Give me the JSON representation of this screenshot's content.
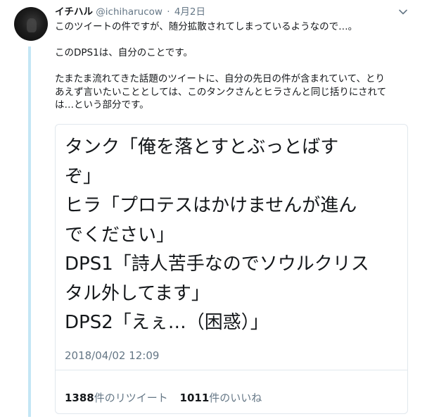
{
  "tweet": {
    "author_name": "イチハル",
    "author_handle": "@ichiharucow",
    "separator": "·",
    "date": "4月2日",
    "text_lines": [
      "このツイートの件ですが、随分拡散されてしまっているようなので…。",
      "",
      "このDPS1は、自分のことです。",
      "",
      "たまたま流れてきた話題のツイートに、自分の先日の件が含まれていて、とり",
      "あえず言いたいこととしては、このタンクさんとヒラさんと同じ括りにされて",
      "は…という部分です。"
    ]
  },
  "quoted": {
    "lines": [
      "タンク「俺を落とすとぶっとばす",
      "ぞ」",
      "ヒラ「プロテスはかけませんが進ん",
      "でください」",
      "DPS1「詩人苦手なのでソウルクリス",
      "タル外してます」",
      "DPS2「えぇ…（困惑）」"
    ],
    "timestamp": "2018/04/02 12:09",
    "retweet_count": "1388",
    "retweet_label": "件のリツイート",
    "like_count": "1011",
    "like_label": "件のいいね"
  }
}
